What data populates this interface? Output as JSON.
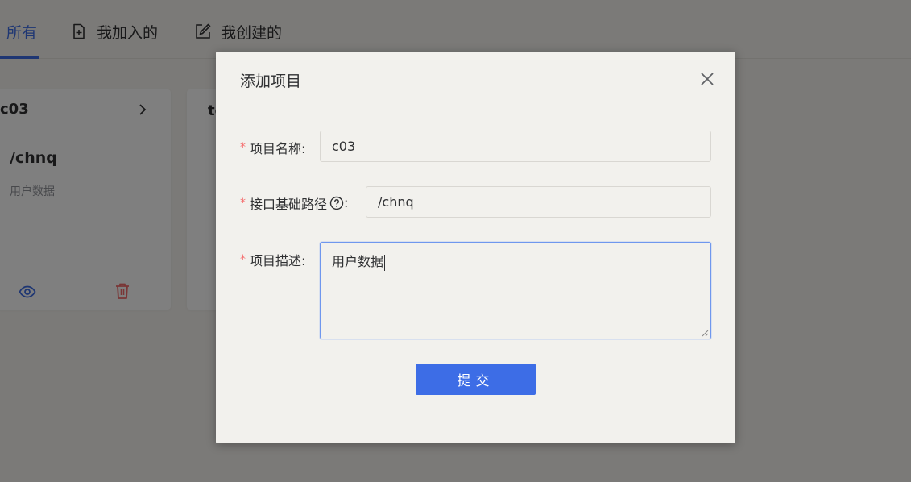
{
  "tabs": [
    {
      "label": "所有",
      "active": true
    },
    {
      "label": "我加入的",
      "icon": "file-plus-icon"
    },
    {
      "label": "我创建的",
      "icon": "edit-icon"
    }
  ],
  "cards": [
    {
      "title": "c03",
      "path": "/chnq",
      "description": "用户数据"
    },
    {
      "title": "te"
    }
  ],
  "dialog": {
    "title": "添加项目",
    "fields": {
      "name": {
        "label": "项目名称:",
        "required_mark": "*",
        "value": "c03"
      },
      "base_path": {
        "label": "接口基础路径",
        "label_suffix": ":",
        "required_mark": "*",
        "value": "/chnq"
      },
      "description": {
        "label": "项目描述:",
        "required_mark": "*",
        "value": "用户数据"
      }
    },
    "submit_label": "提交"
  },
  "colors": {
    "accent": "#3d6de6",
    "danger": "#f56c6c",
    "overlay": "rgba(0,0,0,0.5)"
  }
}
